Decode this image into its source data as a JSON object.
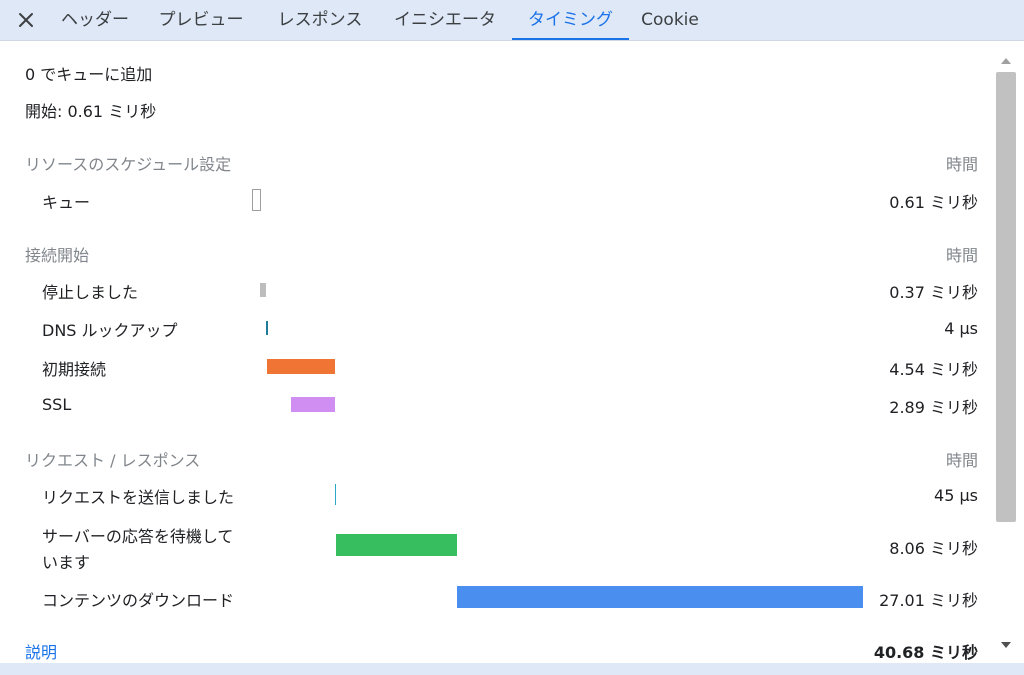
{
  "tabs": [
    {
      "label": "ヘッダー"
    },
    {
      "label": "プレビュー"
    },
    {
      "label": "レスポンス"
    },
    {
      "label": "イニシエータ"
    },
    {
      "label": "タイミング"
    },
    {
      "label": "Cookie"
    }
  ],
  "active_tab": "タイミング",
  "summary": {
    "queued_at": "0 でキューに追加",
    "started_at": "開始: 0.61 ミリ秒"
  },
  "sections": [
    {
      "title": "リソースのスケジュール設定",
      "time_header": "時間",
      "rows": [
        {
          "label": "キュー",
          "duration": "0.61 ミリ秒"
        }
      ]
    },
    {
      "title": "接続開始",
      "time_header": "時間",
      "rows": [
        {
          "label": "停止しました",
          "duration": "0.37 ミリ秒"
        },
        {
          "label": "DNS ルックアップ",
          "duration": "4 µs"
        },
        {
          "label": "初期接続",
          "duration": "4.54 ミリ秒"
        },
        {
          "label": "SSL",
          "duration": "2.89 ミリ秒"
        }
      ]
    },
    {
      "title": "リクエスト / レスポンス",
      "time_header": "時間",
      "rows": [
        {
          "label": "リクエストを送信しました",
          "duration": "45 µs"
        },
        {
          "label": "サーバーの応答を待機して",
          "label_line2": "います",
          "duration": "8.06 ミリ秒"
        },
        {
          "label": "コンテンツのダウンロード",
          "duration": "27.01 ミリ秒"
        }
      ]
    }
  ],
  "footer": {
    "explanation_link": "説明",
    "total": "40.68 ミリ秒"
  },
  "colors": {
    "accent": "#1a73e8",
    "queue": "#ffffff",
    "stalled": "#bdbdbd",
    "dns": "#1f7a9c",
    "initial_connection": "#f07434",
    "ssl": "#d08ef2",
    "request_sent": "#2aa8c4",
    "waiting": "#37be5f",
    "download": "#4a8ef0"
  }
}
